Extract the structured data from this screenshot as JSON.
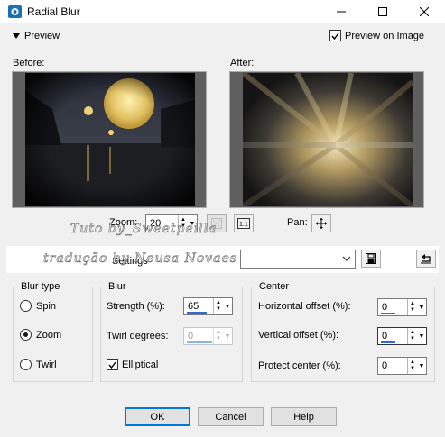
{
  "window": {
    "title": "Radial Blur",
    "icon": "paintshop-icon"
  },
  "preview_toggle": {
    "label": "Preview",
    "icon": "triangle-down-icon"
  },
  "preview_on_image": {
    "label": "Preview on Image",
    "checked": true
  },
  "before": {
    "label": "Before:"
  },
  "after": {
    "label": "After:"
  },
  "zoom": {
    "label": "Zoom:",
    "value": "20"
  },
  "pan": {
    "label": "Pan:"
  },
  "settings": {
    "label": "Settings",
    "value": ""
  },
  "watermark": {
    "line1": "Tuto by_Sweetpeilla",
    "line2": "tradução by Neusa Novaes"
  },
  "blur_type": {
    "title": "Blur type",
    "options": [
      {
        "label": "Spin",
        "selected": false
      },
      {
        "label": "Zoom",
        "selected": true
      },
      {
        "label": "Twirl",
        "selected": false
      }
    ]
  },
  "blur": {
    "title": "Blur",
    "strength_label": "Strength (%):",
    "strength_value": "65",
    "strength_fraction": 0.65,
    "twirl_label": "Twirl degrees:",
    "twirl_value": "0",
    "elliptical_label": "Elliptical",
    "elliptical_checked": true
  },
  "center": {
    "title": "Center",
    "h_label": "Horizontal offset (%):",
    "h_value": "0",
    "v_label": "Vertical offset (%):",
    "v_value": "0",
    "p_label": "Protect center (%):",
    "p_value": "0"
  },
  "buttons": {
    "ok": "OK",
    "cancel": "Cancel",
    "help": "Help"
  }
}
